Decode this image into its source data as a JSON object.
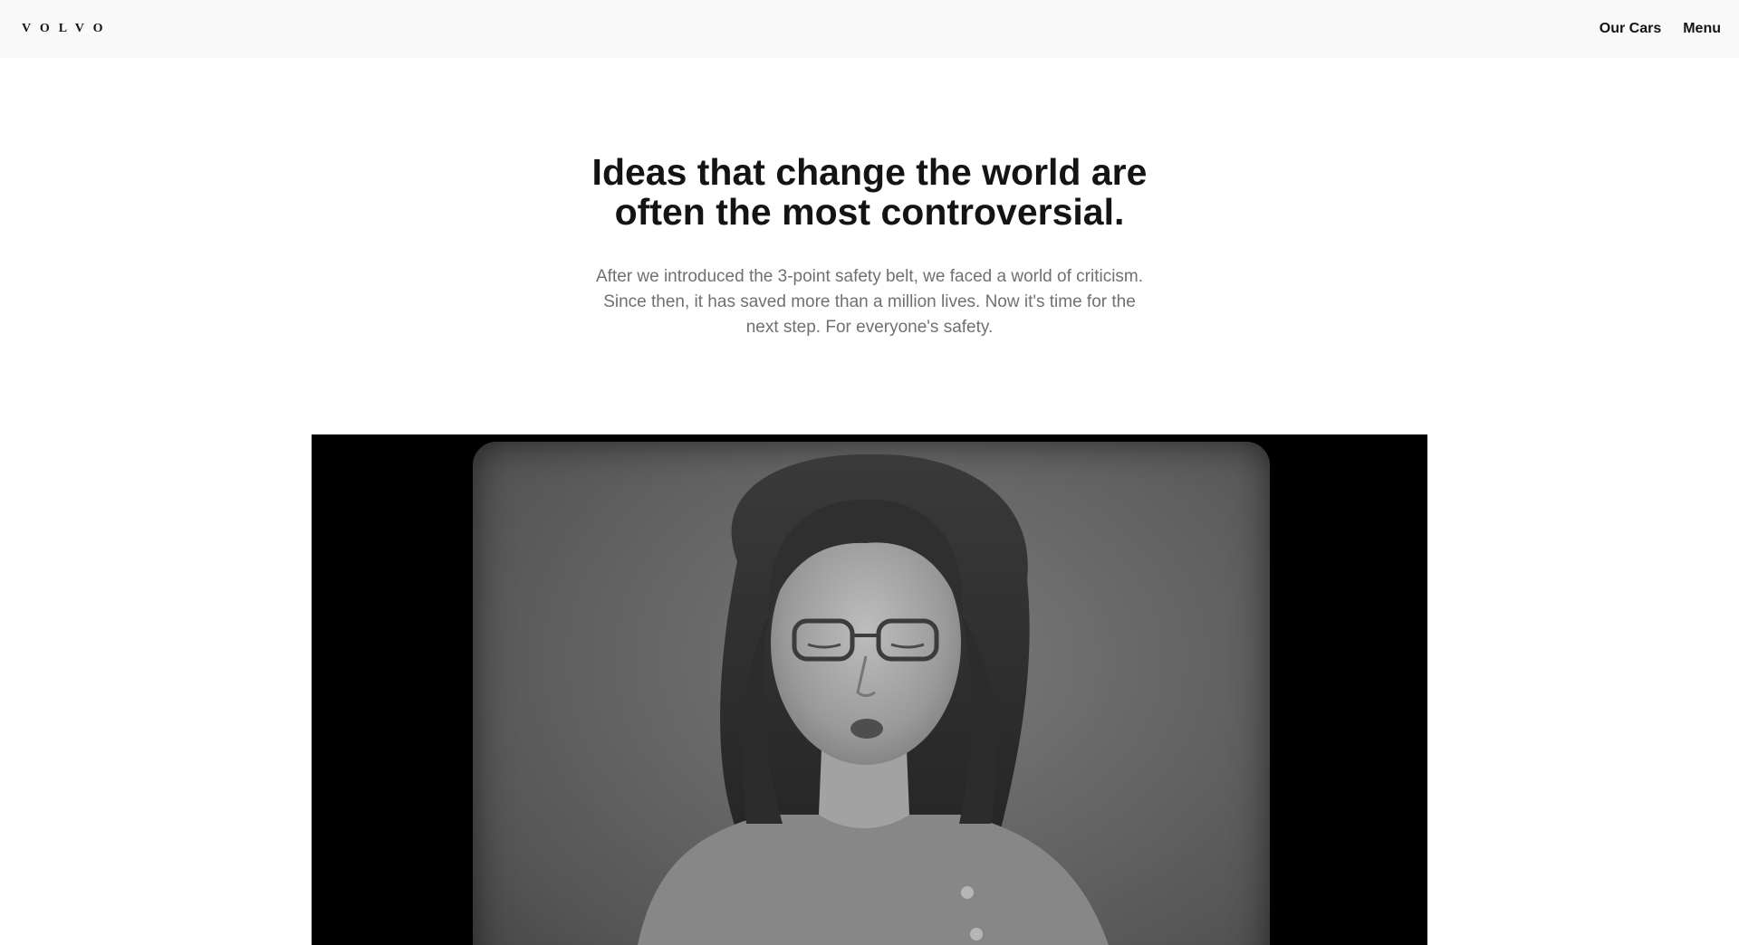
{
  "header": {
    "logo_text": "VOLVO",
    "nav": [
      {
        "label": "Our Cars"
      },
      {
        "label": "Menu"
      }
    ]
  },
  "hero": {
    "title": "Ideas that change the world are often the most controversial.",
    "description": "After we introduced the 3-point safety belt, we faced a world of criticism. Since then, it has saved more than a million lives. Now it's time for the next step. For everyone's safety."
  },
  "media": {
    "type": "video",
    "colors": {
      "background": "#000000",
      "frame": "#6b6b6b"
    }
  }
}
